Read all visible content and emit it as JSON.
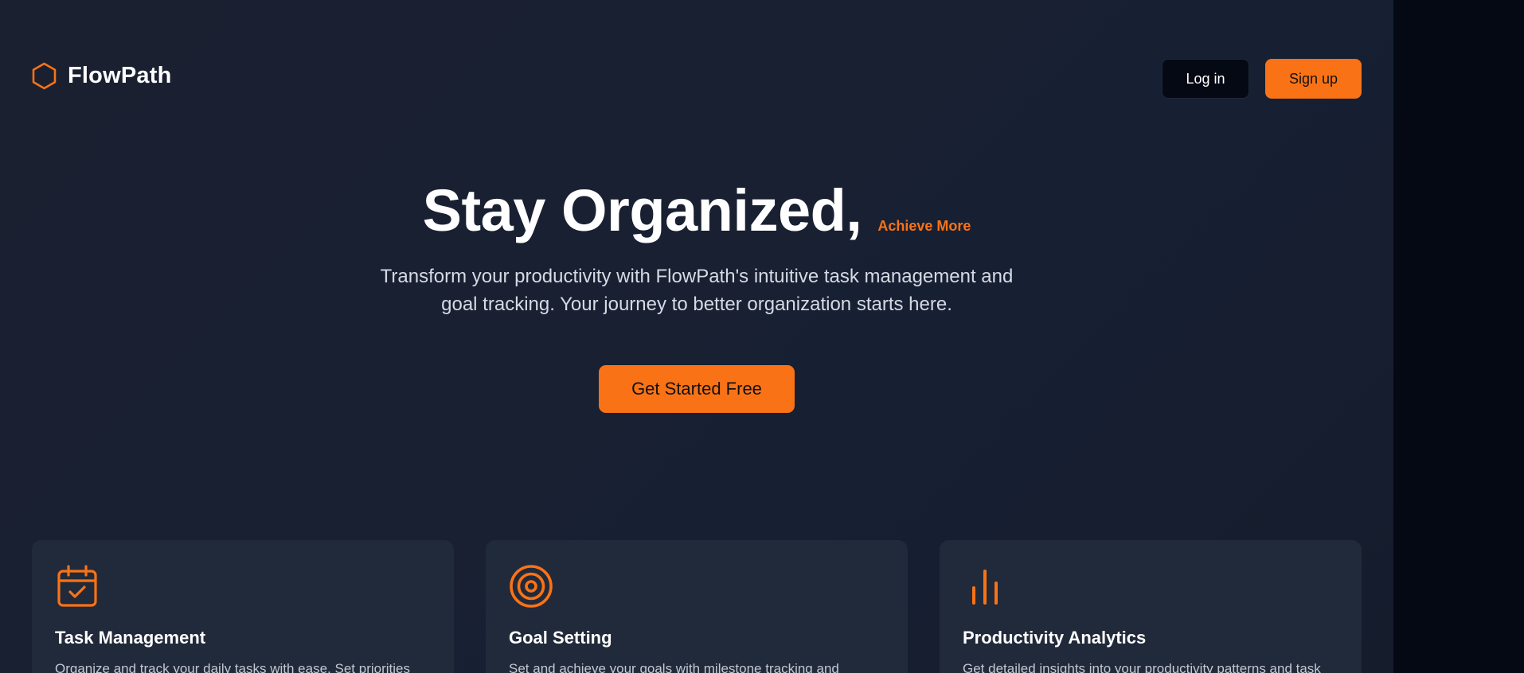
{
  "brand": {
    "name": "FlowPath",
    "accent_color": "#f97316",
    "icon": "hexagon-icon"
  },
  "nav": {
    "login_label": "Log in",
    "signup_label": "Sign up"
  },
  "hero": {
    "title": "Stay Organized,",
    "accent_text": "Achieve More",
    "subtitle_line1": "Transform your productivity with FlowPath's intuitive task management and",
    "subtitle_line2": "goal tracking. Your journey to better organization starts here.",
    "cta_label": "Get Started Free"
  },
  "features": [
    {
      "icon": "calendar-check-icon",
      "title": "Task Management",
      "description": "Organize and track your daily tasks with ease. Set priorities"
    },
    {
      "icon": "target-icon",
      "title": "Goal Setting",
      "description": "Set and achieve your goals with milestone tracking and"
    },
    {
      "icon": "bar-chart-icon",
      "title": "Productivity Analytics",
      "description": "Get detailed insights into your productivity patterns and task"
    }
  ]
}
